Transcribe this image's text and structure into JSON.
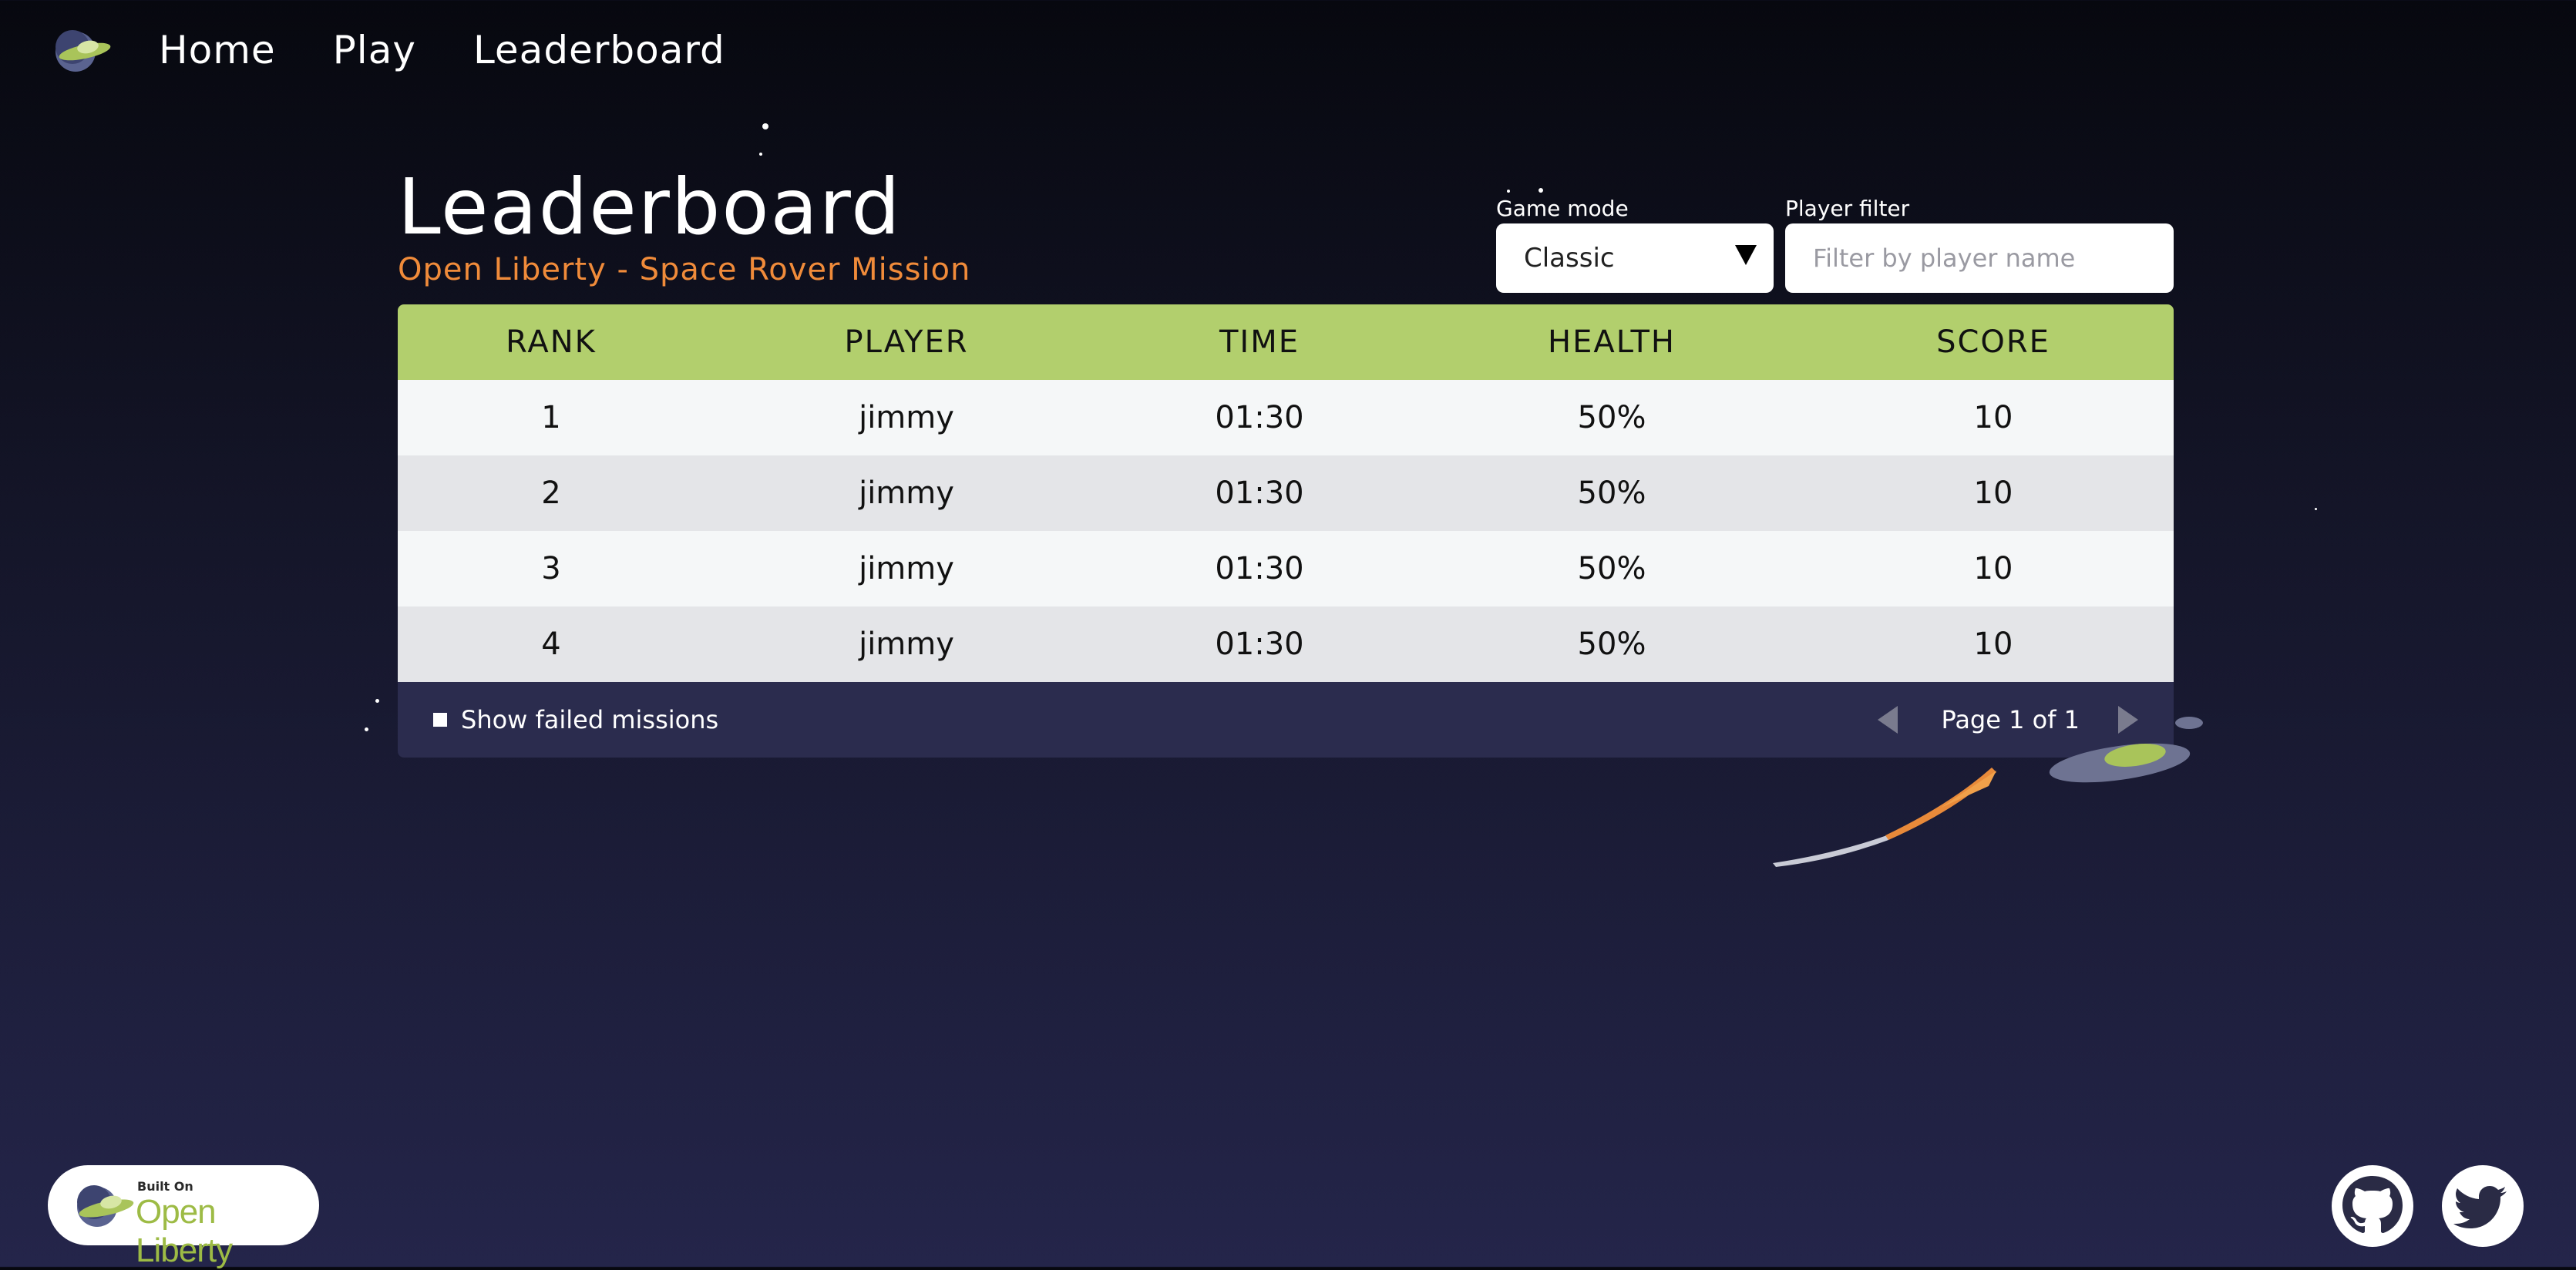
{
  "nav": {
    "logo_icon": "ufo-logo-icon",
    "links": [
      "Home",
      "Play",
      "Leaderboard"
    ]
  },
  "page": {
    "title": "Leaderboard",
    "subtitle": "Open Liberty - Space Rover Mission"
  },
  "controls": {
    "game_mode_label": "Game mode",
    "game_mode_value": "Classic",
    "player_filter_label": "Player filter",
    "player_filter_placeholder": "Filter by player name"
  },
  "table": {
    "headers": [
      "RANK",
      "PLAYER",
      "TIME",
      "HEALTH",
      "SCORE"
    ],
    "rows": [
      [
        "1",
        "jimmy",
        "01:30",
        "50%",
        "10"
      ],
      [
        "2",
        "jimmy",
        "01:30",
        "50%",
        "10"
      ],
      [
        "3",
        "jimmy",
        "01:30",
        "50%",
        "10"
      ],
      [
        "4",
        "jimmy",
        "01:30",
        "50%",
        "10"
      ]
    ]
  },
  "footer_bar": {
    "show_failed_label": "Show failed missions",
    "page_label": "Page 1 of 1"
  },
  "footer": {
    "built_on": "Built On",
    "brand": "Open Liberty",
    "social_icons": [
      "github-icon",
      "twitter-icon"
    ]
  },
  "colors": {
    "header_green": "#b2cf6d",
    "subtitle_orange": "#f08b3a",
    "footer_bar": "#2b2c4e"
  }
}
